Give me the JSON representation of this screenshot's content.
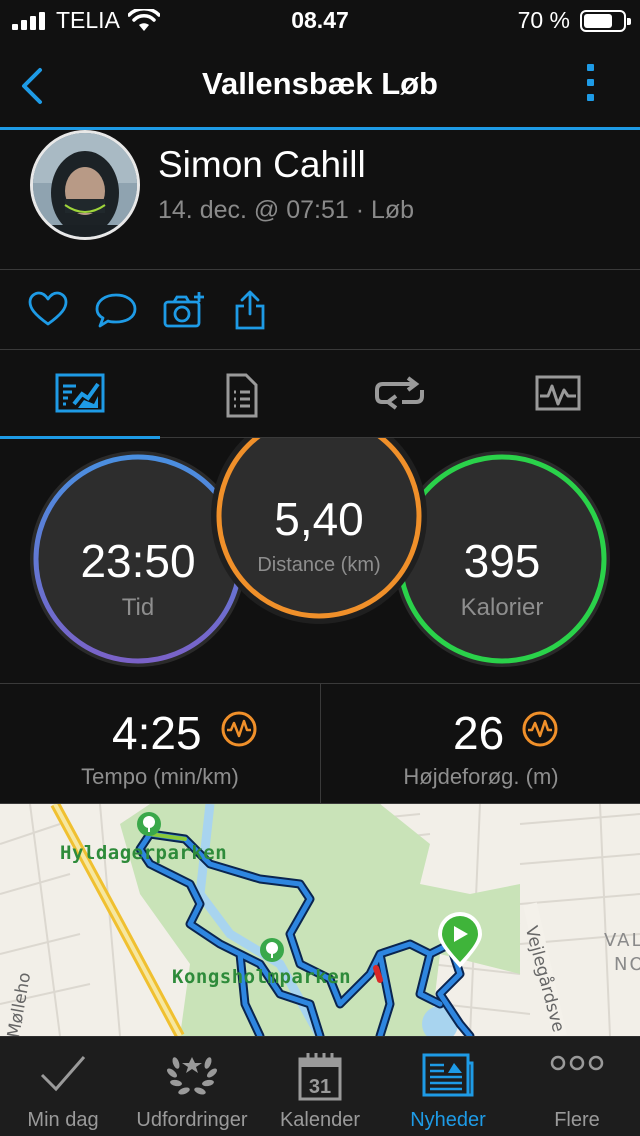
{
  "status_bar": {
    "carrier": "TELIA",
    "time": "08.47",
    "battery": "70 %"
  },
  "header": {
    "title": "Vallensbæk Løb"
  },
  "profile": {
    "name": "Simon Cahill",
    "meta": "14. dec. @ 07:51 · Løb"
  },
  "actions": [
    "heart-icon",
    "comment-icon",
    "camera-add-icon",
    "share-icon"
  ],
  "tabs": [
    {
      "icon": "map-summary-icon",
      "active": true
    },
    {
      "icon": "details-sheet-icon",
      "active": false
    },
    {
      "icon": "laps-icon",
      "active": false
    },
    {
      "icon": "chart-icon",
      "active": false
    }
  ],
  "stats": {
    "time": {
      "value": "23:50",
      "label": "Tid"
    },
    "distance": {
      "value": "5,40",
      "label": "Distance (km)"
    },
    "calories": {
      "value": "395",
      "label": "Kalorier"
    }
  },
  "metrics": {
    "tempo": {
      "value": "4:25",
      "label": "Tempo (min/km)"
    },
    "elevation": {
      "value": "26",
      "label": "Højdeforøg. (m)"
    }
  },
  "map": {
    "labels": {
      "park1": "Hyldagerparken",
      "park2": "Kongsholmparken",
      "street1": "Vejlegårdsve",
      "street2": "Mølleho",
      "area1": "VAL",
      "area2": "NO"
    }
  },
  "tabbar": [
    {
      "label": "Min dag",
      "icon": "check-icon",
      "active": false
    },
    {
      "label": "Udfordringer",
      "icon": "laurel-icon",
      "active": false
    },
    {
      "label": "Kalender",
      "icon": "calendar-icon",
      "day": "31",
      "active": false
    },
    {
      "label": "Nyheder",
      "icon": "news-icon",
      "active": true
    },
    {
      "label": "Flere",
      "icon": "more-dots-icon",
      "active": false
    }
  ],
  "colors": {
    "accent": "#1e9be6",
    "time_ring": [
      "#4a8fe0",
      "#7a62c8"
    ],
    "distance_ring": "#f0902a",
    "calories_ring": "#2ad24a",
    "route": "#1e7fd8"
  }
}
